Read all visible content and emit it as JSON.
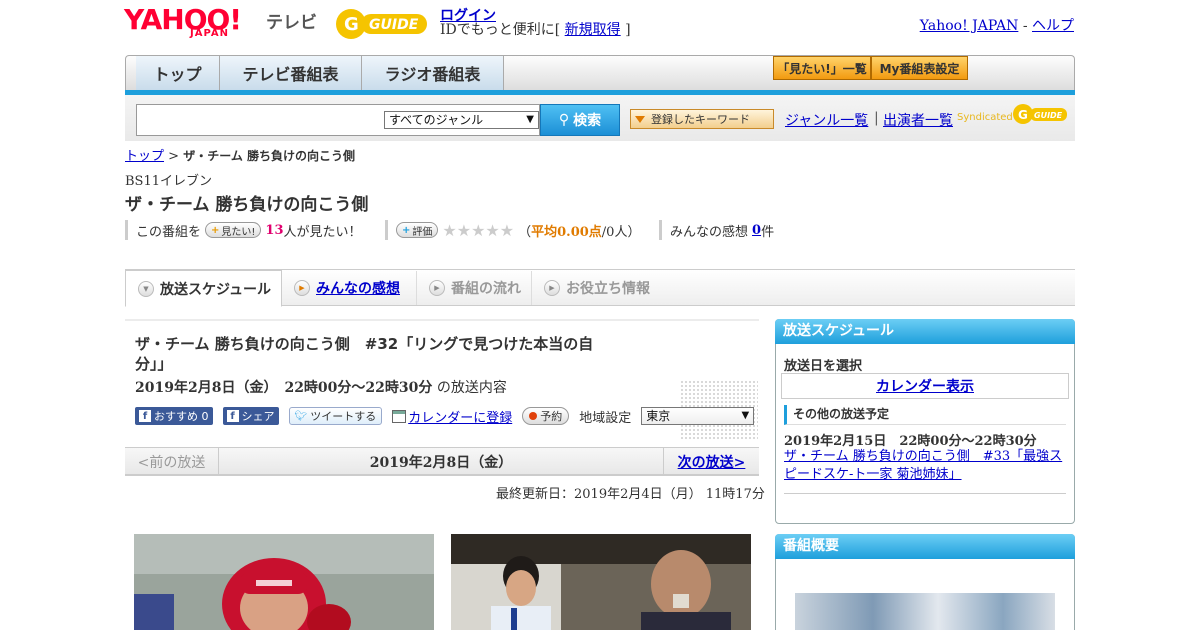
{
  "header": {
    "yahoo": "YAHOO!",
    "japan": "JAPAN",
    "tv": "テレビ",
    "gguide": "GUIDE",
    "login": "ログイン",
    "id_text": "IDでもっと便利に[",
    "signup": "新規取得",
    "id_text_close": "]",
    "yahoo_japan_link": "Yahoo! JAPAN",
    "separator": "-",
    "help_link": "ヘルプ"
  },
  "nav": {
    "tabs": [
      "トップ",
      "テレビ番組表",
      "ラジオ番組表"
    ],
    "mitai_list": "「見たい!」一覧",
    "my_schedule": "My番組表設定"
  },
  "search": {
    "genre_selected": "すべてのジャンル",
    "search_button": "検索",
    "registered_keywords": "登録したキーワード",
    "genre_list": "ジャンル一覧",
    "link_separator": "|",
    "cast_list": "出演者一覧",
    "syndicated": "Syndicated",
    "gguide_small": "GUIDE"
  },
  "breadcrumb": {
    "top": "トップ",
    "sep": ">",
    "current": "ザ・チーム 勝ち負けの向こう側"
  },
  "program": {
    "channel": "BS11イレブン",
    "title": "ザ・チーム 勝ち負けの向こう側"
  },
  "infobar": {
    "prefix": "この番組を",
    "mitai_button": "見たい!",
    "mitai_count": "13",
    "mitai_suffix": "人が見たい！",
    "rate_button": "評価",
    "stars": "★★★★★",
    "avg_open": "（",
    "avg_label": "平均0.00点",
    "avg_people": "/0人）",
    "kanso_label": "みんなの感想",
    "kanso_count": "0",
    "kanso_suffix": "件"
  },
  "tabs": [
    {
      "label": "放送スケジュール"
    },
    {
      "label": "みんなの感想"
    },
    {
      "label": "番組の流れ"
    },
    {
      "label": "お役立ち情報"
    }
  ],
  "episode": {
    "title": "ザ・チーム 勝ち負けの向こう側　#32「リングで見つけた本当の自分」」",
    "date": "2019年2月8日（金）　22時00分～22時30分",
    "date_suffix": "の放送内容",
    "fb_recommend": "おすすめ 0",
    "fb_share": "シェア",
    "tweet": "ツイートする",
    "calendar": "カレンダーに登録",
    "reserve": "予約",
    "region_label": "地域設定",
    "region_value": "東京"
  },
  "datenav": {
    "prev": "<前の放送",
    "current": "2019年2月8日（金）",
    "next": "次の放送>"
  },
  "updated": "最終更新日：2019年2月4日（月） 11時17分",
  "sidebar": {
    "schedule_title": "放送スケジュール",
    "select_date": "放送日を選択",
    "calendar_button": "カレンダー表示",
    "other_title": "その他の放送予定",
    "other_date": "2019年2月15日　22時00分～22時30分",
    "other_link": "ザ・チーム 勝ち負けの向こう側　#33「最強スピードスケ-ト一家 菊池姉妹」",
    "overview_title": "番組概要"
  },
  "colors": {
    "accent_blue": "#1e9fdc",
    "yahoo_red": "#ff0033",
    "gguide_yellow": "#f5c400",
    "mitai_pink": "#e0006e",
    "avg_orange": "#e07b00"
  }
}
